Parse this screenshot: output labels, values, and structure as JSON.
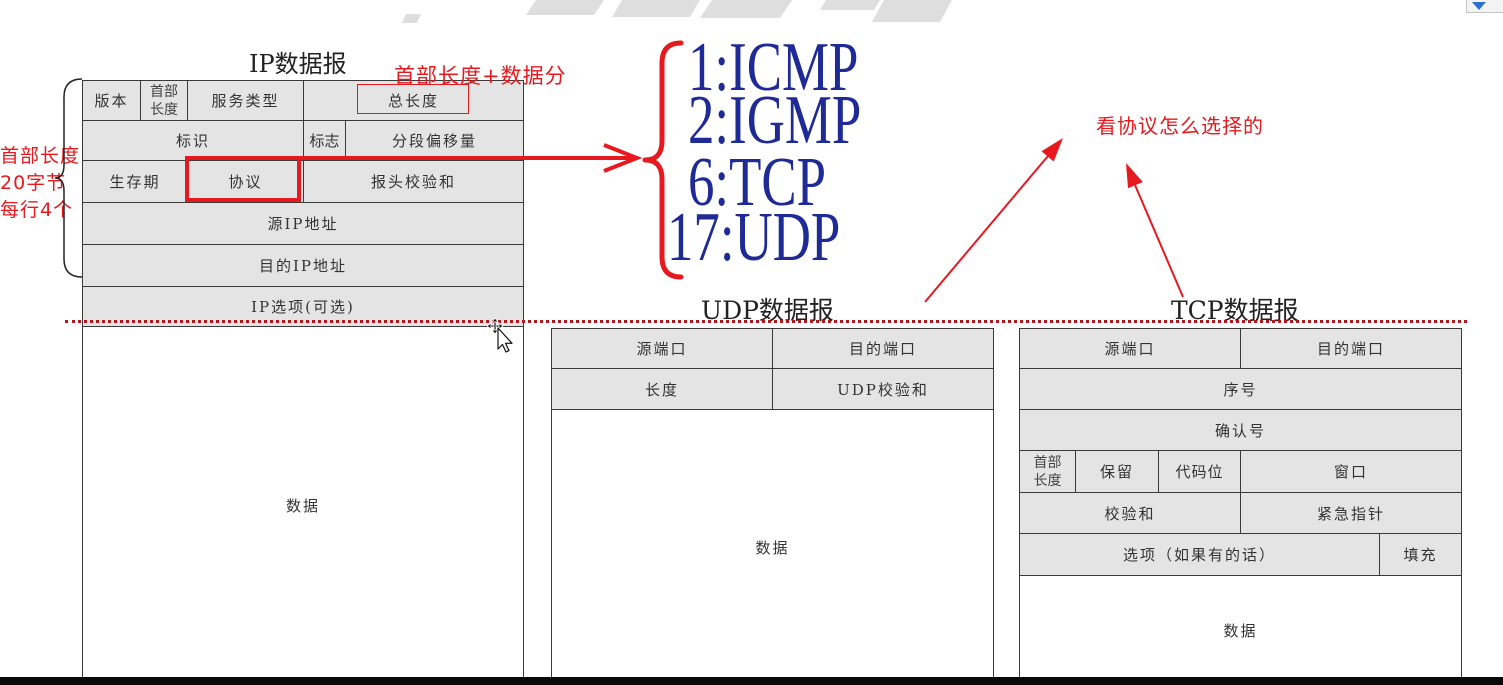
{
  "ip_datagram": {
    "title": "IP数据报",
    "version": "版本",
    "ihl": [
      "首部",
      "长度"
    ],
    "tos": "服务类型",
    "total_length": "总长度",
    "identification": "标识",
    "flags": "标志",
    "fragment_offset": "分段偏移量",
    "ttl": "生存期",
    "protocol": "协议",
    "header_checksum": "报头校验和",
    "source_ip": "源IP地址",
    "dest_ip": "目的IP地址",
    "options": "IP选项(可选)",
    "data": "数据"
  },
  "udp_datagram": {
    "title": "UDP数据报",
    "source_port": "源端口",
    "dest_port": "目的端口",
    "length": "长度",
    "checksum": "UDP校验和",
    "data": "数据"
  },
  "tcp_datagram": {
    "title": "TCP数据报",
    "source_port": "源端口",
    "dest_port": "目的端口",
    "sequence_number": "序号",
    "ack_number": "确认号",
    "header_length": [
      "首部",
      "长度"
    ],
    "reserved": "保留",
    "code_bits": "代码位",
    "window": "窗口",
    "checksum": "校验和",
    "urgent_pointer": "紧急指针",
    "options": "选项（如果有的话）",
    "padding": "填充",
    "data": "数据"
  },
  "annotations": {
    "total_length_note": "首部长度+数据分",
    "header_note": [
      "首部长度",
      "20字节",
      "每行4个"
    ],
    "protocol_values": [
      "1:ICMP",
      "2:IGMP",
      "6:TCP",
      "17:UDP"
    ],
    "protocol_note": "看协议怎么选择的"
  },
  "colors": {
    "annotation_red": "#e8191e",
    "protocol_blue": "#1e2a96",
    "cell_fill": "#e4e4e4",
    "divider_red": "#b5151b"
  },
  "icons": {
    "cursor": "move-cursor-icon",
    "dropdown": "dropdown-icon"
  }
}
